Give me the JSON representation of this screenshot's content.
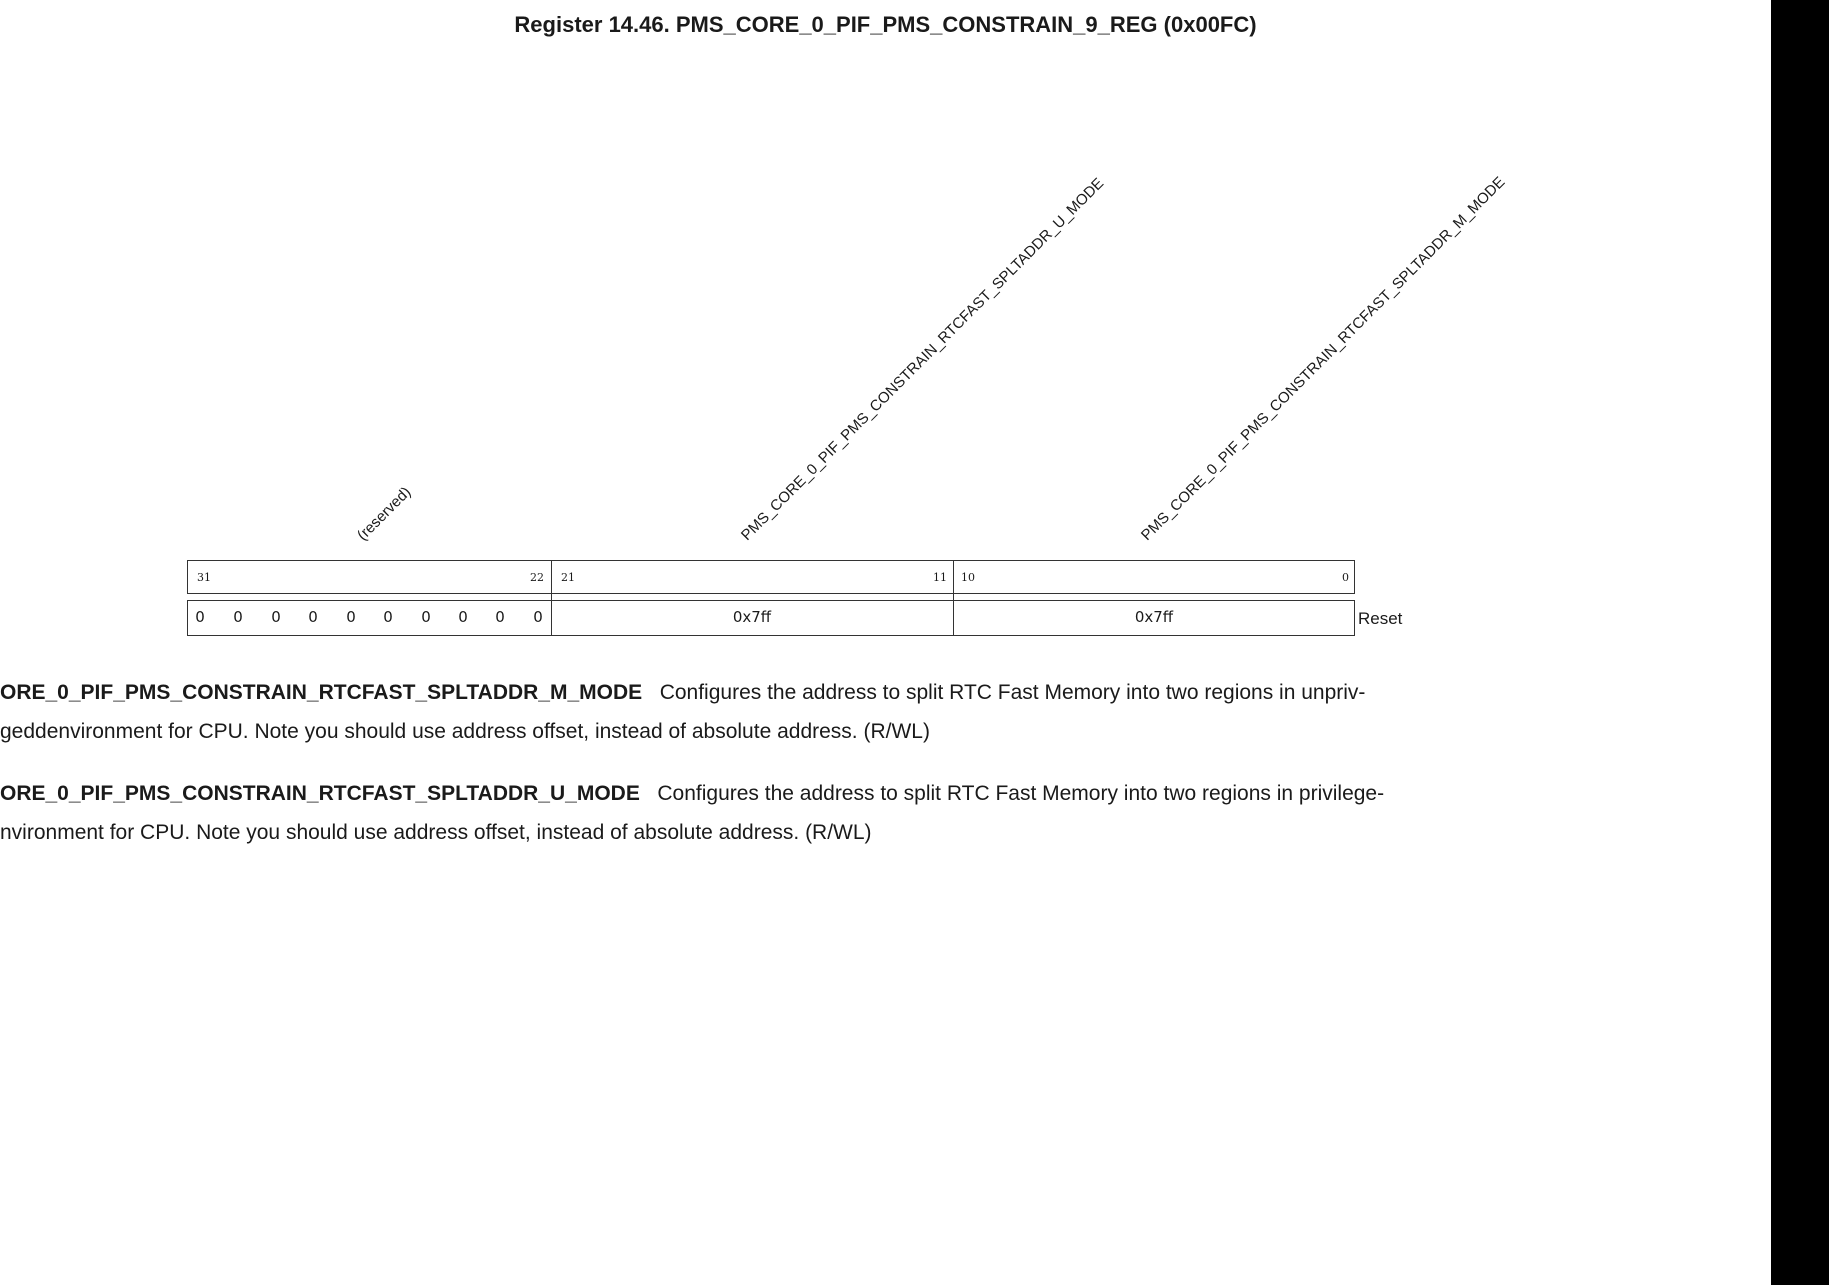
{
  "register": {
    "title": "Register 14.46. PMS_CORE_0_PIF_PMS_CONSTRAIN_9_REG (0x00FC)"
  },
  "fields": [
    {
      "name": "(reserved)",
      "bits_hi": "31",
      "bits_lo": "22",
      "reset_bits": [
        "0",
        "0",
        "0",
        "0",
        "0",
        "0",
        "0",
        "0",
        "0",
        "0"
      ]
    },
    {
      "name": "PMS_CORE_0_PIF_PMS_CONSTRAIN_RTCFAST_SPLTADDR_U_MODE",
      "bits_hi": "21",
      "bits_lo": "11",
      "reset": "0x7ff"
    },
    {
      "name": "PMS_CORE_0_PIF_PMS_CONSTRAIN_RTCFAST_SPLTADDR_M_MODE",
      "bits_hi": "10",
      "bits_lo": "0",
      "reset": "0x7ff"
    }
  ],
  "reset_label": "Reset",
  "descriptions": [
    {
      "field": "ORE_0_PIF_PMS_CONSTRAIN_RTCFAST_SPLTADDR_M_MODE",
      "line1": "Configures the address to split RTC Fast Memory into two regions in unpriv-",
      "line2": "geddenvironment for CPU. Note you should use address offset, instead of absolute address. (R/WL)"
    },
    {
      "field": "ORE_0_PIF_PMS_CONSTRAIN_RTCFAST_SPLTADDR_U_MODE",
      "line1": "Configures the address to split RTC Fast Memory into two regions in privilege-",
      "line2": "nvironment for CPU. Note you should use address offset, instead of absolute address. (R/WL)"
    }
  ]
}
